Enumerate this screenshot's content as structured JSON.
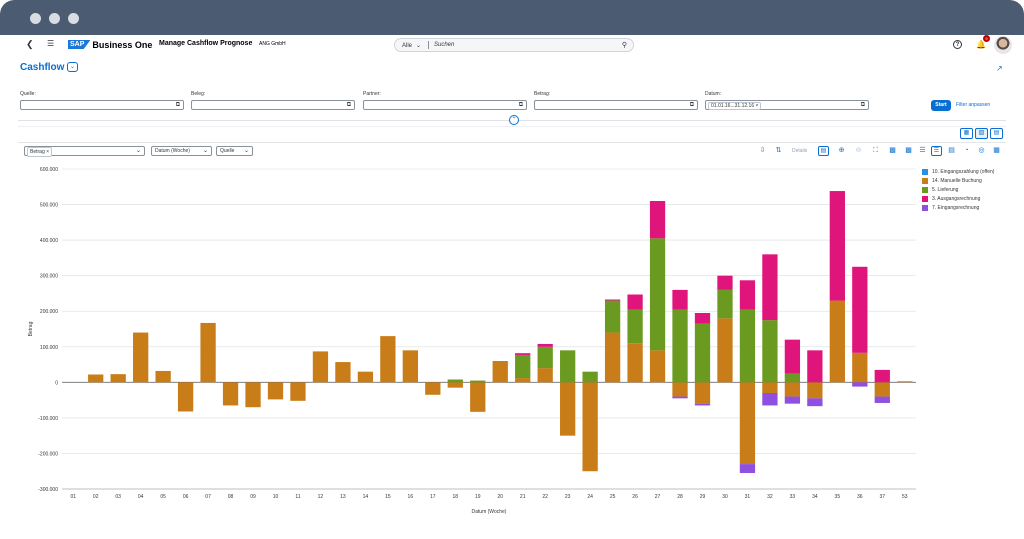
{
  "window": {
    "dots": [
      "#d8dde4",
      "#d8dde4",
      "#d8dde4"
    ]
  },
  "shell": {
    "back_icon": "chevron-left",
    "menu_icon": "list",
    "logo_sap": "SAP",
    "logo_product": "Business One",
    "app_title": "Manage Cashflow Prognose",
    "company": "ANG GmbH",
    "search_scope": "Alle",
    "search_placeholder": "Suchen",
    "notifications_count": "9"
  },
  "page": {
    "title": "Cashflow"
  },
  "filters": {
    "items": [
      {
        "label": "Quelle:",
        "value": ""
      },
      {
        "label": "Beleg:",
        "value": ""
      },
      {
        "label": "Partner:",
        "value": ""
      },
      {
        "label": "Betrag:",
        "value": ""
      },
      {
        "label": "Datum:",
        "value": "01.01.16...31.12.16"
      }
    ],
    "start_label": "Start",
    "adapt_label": "Filter anpassen"
  },
  "toolbar": {
    "measure_token": "Betrag",
    "dimension1": "Datum (Woche)",
    "dimension2": "Quelle",
    "details_label": "Details"
  },
  "colors": {
    "accent": "#0a6ed1",
    "s10": "#2b8de3",
    "s14": "#c87d18",
    "s5": "#6a9a1f",
    "s3": "#e0157c",
    "s7": "#8f4fe0"
  },
  "chart_data": {
    "type": "bar",
    "stacked": true,
    "ylabel": "Betrag",
    "xlabel": "Datum (Woche)",
    "ylim": [
      -300000,
      600000
    ],
    "yticks": [
      "600.000",
      "500.000",
      "400.000",
      "300.000",
      "200.000",
      "100.000",
      "0",
      "-100.000",
      "-200.000",
      "-300.000"
    ],
    "categories": [
      "01",
      "02",
      "03",
      "04",
      "05",
      "06",
      "07",
      "08",
      "09",
      "10",
      "11",
      "12",
      "13",
      "14",
      "15",
      "16",
      "17",
      "18",
      "19",
      "20",
      "21",
      "22",
      "23",
      "24",
      "25",
      "26",
      "27",
      "28",
      "29",
      "30",
      "31",
      "32",
      "33",
      "34",
      "35",
      "36",
      "37",
      "53"
    ],
    "series": [
      {
        "name": "10. Eingangszahlung (offen)",
        "color": "#2b8de3",
        "values": [
          0,
          0,
          0,
          0,
          0,
          0,
          0,
          0,
          0,
          0,
          0,
          0,
          0,
          0,
          0,
          0,
          0,
          0,
          0,
          0,
          0,
          0,
          0,
          0,
          0,
          0,
          0,
          0,
          0,
          0,
          0,
          0,
          0,
          0,
          0,
          0,
          0,
          0
        ]
      },
      {
        "name": "14. Manuelle Buchung",
        "color": "#c87d18",
        "values": [
          0,
          22000,
          23000,
          140000,
          32000,
          -82000,
          167000,
          -65000,
          -70000,
          -48000,
          -52000,
          87000,
          57000,
          30000,
          130000,
          90000,
          -35000,
          -15000,
          -83000,
          60000,
          12000,
          40000,
          -150000,
          -250000,
          140000,
          110000,
          90000,
          -40000,
          -60000,
          180000,
          -230000,
          -30000,
          -40000,
          -45000,
          230000,
          83000,
          -40000,
          3000
        ]
      },
      {
        "name": "5. Lieferung",
        "color": "#6a9a1f",
        "values": [
          0,
          0,
          0,
          0,
          0,
          0,
          0,
          0,
          0,
          0,
          0,
          0,
          0,
          0,
          0,
          0,
          0,
          8000,
          5000,
          0,
          65000,
          60000,
          90000,
          30000,
          90000,
          95000,
          315000,
          205000,
          165000,
          80000,
          205000,
          175000,
          25000,
          0,
          0,
          0,
          0,
          0
        ]
      },
      {
        "name": "3. Ausgangsrechnung",
        "color": "#e0157c",
        "values": [
          0,
          0,
          0,
          0,
          0,
          0,
          0,
          0,
          0,
          0,
          0,
          0,
          0,
          0,
          0,
          0,
          0,
          0,
          0,
          0,
          5000,
          8000,
          0,
          0,
          3000,
          42000,
          105000,
          55000,
          30000,
          40000,
          82000,
          185000,
          95000,
          90000,
          308000,
          242000,
          35000,
          0
        ]
      },
      {
        "name": "7. Eingangsrechnung",
        "color": "#8f4fe0",
        "values": [
          0,
          0,
          0,
          0,
          0,
          0,
          0,
          0,
          0,
          0,
          0,
          0,
          0,
          0,
          0,
          0,
          0,
          0,
          0,
          0,
          0,
          0,
          0,
          0,
          0,
          0,
          0,
          -5000,
          -5000,
          0,
          -25000,
          -35000,
          -20000,
          -22000,
          0,
          -12000,
          -18000,
          0
        ]
      }
    ]
  }
}
